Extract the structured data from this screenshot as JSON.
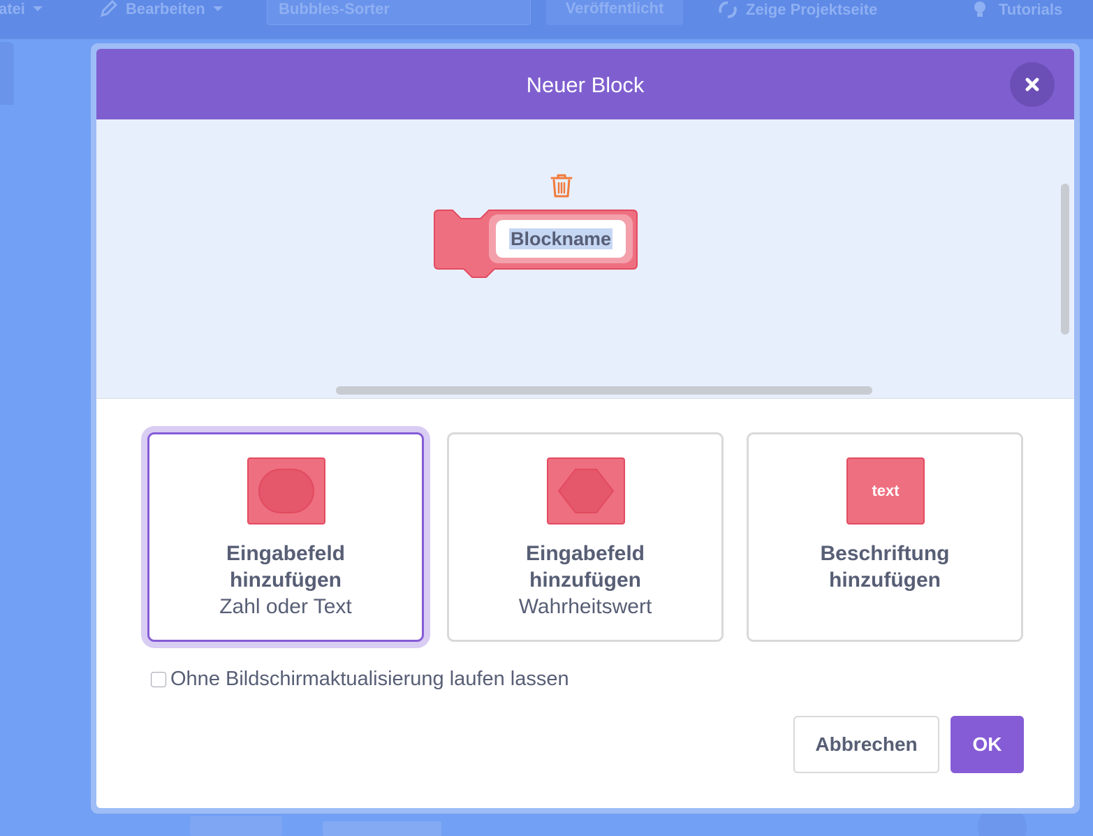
{
  "menubar": {
    "file": "atei",
    "edit": "Bearbeiten",
    "project_title": "Bubbles-Sorter",
    "published": "Veröffentlicht",
    "project_page": "Zeige Projektseite",
    "tutorials": "Tutorials"
  },
  "modal": {
    "title": "Neuer Block",
    "block_name": "Blockname",
    "options": [
      {
        "title_line1": "Eingabefeld",
        "title_line2": "hinzufügen",
        "subtitle": "Zahl oder Text"
      },
      {
        "title_line1": "Eingabefeld",
        "title_line2": "hinzufügen",
        "subtitle": "Wahrheitswert"
      },
      {
        "title_line1": "Beschriftung",
        "title_line2": "hinzufügen",
        "subtitle": "",
        "icon_text": "text"
      }
    ],
    "run_without_refresh": "Ohne Bildschirmaktualisierung laufen lassen",
    "cancel_label": "Abbrechen",
    "ok_label": "OK"
  },
  "colors": {
    "accent": "#855cd6",
    "header": "#7f5fcf",
    "block": "#ee6f80",
    "text": "#575e75"
  }
}
